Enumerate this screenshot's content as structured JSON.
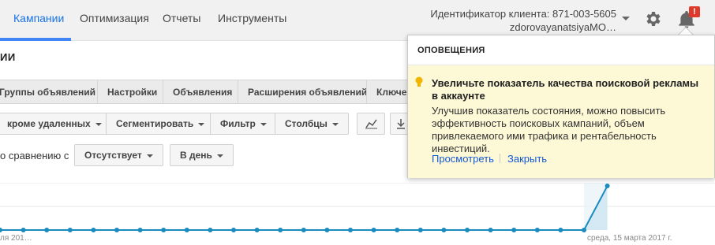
{
  "nav": {
    "items": [
      "Кампании",
      "Оптимизация",
      "Отчеты",
      "Инструменты"
    ]
  },
  "account": {
    "client_id": "Идентификатор клиента: 871-003-5605",
    "email": "zdorovayanatsiyaMO…"
  },
  "notif_badge": "!",
  "section_title": "ИИ",
  "tabs": [
    "Группы объявлений",
    "Настройки",
    "Объявления",
    "Расширения объявлений",
    "Ключев"
  ],
  "toolbar": {
    "filter_removed": "кроме удаленных",
    "segment": "Сегментировать",
    "filter": "Фильтр",
    "columns": "Столбцы"
  },
  "compare": {
    "label": "о сравнению с",
    "value": "Отсутствует",
    "period": "В день"
  },
  "chart_data": {
    "type": "line",
    "x_label_left": "ля 201…",
    "x_label_right": "среда, 15 марта 2017 г.",
    "values": [
      0,
      0,
      0,
      0,
      0,
      0,
      0,
      0,
      0,
      0,
      0,
      0,
      0,
      0,
      0,
      0,
      0,
      0,
      0,
      0,
      0,
      0,
      0,
      0,
      0,
      0,
      1
    ],
    "color": "#1a8bbf"
  },
  "popup": {
    "header": "ОПОВЕЩЕНИЯ",
    "title": "Увеличьте показатель качества поисковой рекламы в аккаунте",
    "text": "Улучшив показатель состояния, можно повысить эффективность поисковых кампаний, объем привлекаемого ими трафика и рентабельность инвестиций.",
    "view": "Просмотреть",
    "close": "Закрыть"
  }
}
